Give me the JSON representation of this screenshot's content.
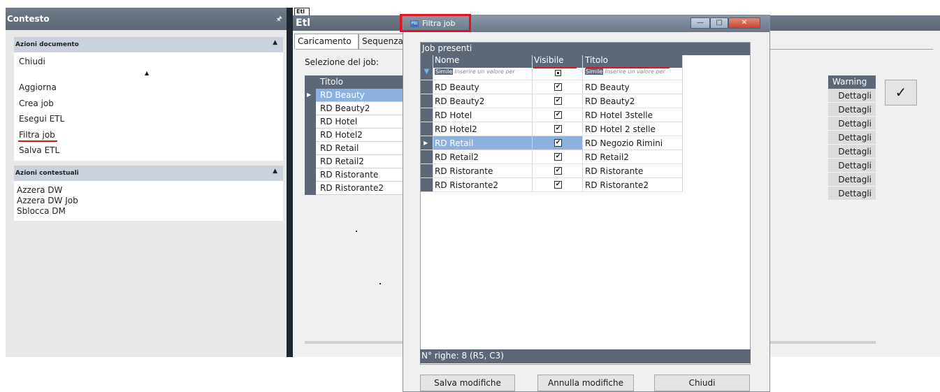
{
  "left_panel": {
    "title": "Contesto",
    "pin_icon": "pin-icon",
    "doc_actions": {
      "header": "Azioni documento",
      "items": [
        "Chiudi",
        "Aggiorna",
        "Crea job",
        "Esegui ETL",
        "Filtra job",
        "Salva ETL"
      ]
    },
    "context_actions": {
      "header": "Azioni contestuali",
      "items": [
        "Azzera DW",
        "Azzera DW Job",
        "Sblocca DM"
      ]
    }
  },
  "etl": {
    "doc_tab": "Etl",
    "title": "Etl",
    "tabs": [
      "Caricamento",
      "Sequenza"
    ],
    "selection_label": "Selezione del job:",
    "grid": {
      "header": "Titolo",
      "rows": [
        "RD Beauty",
        "RD Beauty2",
        "RD Hotel",
        "RD Hotel2",
        "RD Retail",
        "RD Retail2",
        "RD Ristorante",
        "RD Ristorante2"
      ],
      "selected_index": 0
    },
    "warning": {
      "header": "Warning",
      "rows": [
        "Dettagli",
        "Dettagli",
        "Dettagli",
        "Dettagli",
        "Dettagli",
        "Dettagli",
        "Dettagli",
        "Dettagli"
      ]
    },
    "confirm_glyph": "✓"
  },
  "dialog": {
    "title": "Filtra job",
    "panel_title": "Job presenti",
    "columns": [
      "Nome",
      "Visibile",
      "Titolo"
    ],
    "filter": {
      "simile_label": "Simile",
      "placeholder": "Inserire un valore per"
    },
    "rows": [
      {
        "nome": "RD Beauty",
        "visibile": true,
        "titolo": "RD Beauty"
      },
      {
        "nome": "RD Beauty2",
        "visibile": true,
        "titolo": "RD Beauty2"
      },
      {
        "nome": "RD Hotel",
        "visibile": true,
        "titolo": "RD Hotel 3stelle"
      },
      {
        "nome": "RD Hotel2",
        "visibile": true,
        "titolo": "RD Hotel 2 stelle"
      },
      {
        "nome": "RD Retail",
        "visibile": true,
        "titolo": "RD Negozio Rimini"
      },
      {
        "nome": "RD Retail2",
        "visibile": true,
        "titolo": "RD Retail2"
      },
      {
        "nome": "RD Ristorante",
        "visibile": true,
        "titolo": "RD Ristorante"
      },
      {
        "nome": "RD Ristorante2",
        "visibile": true,
        "titolo": "RD Ristorante2"
      }
    ],
    "selected_row": 4,
    "status": "N° righe: 8  (R5, C3)",
    "buttons": {
      "save": "Salva modifiche",
      "cancel": "Annulla modifiche",
      "close": "Chiudi"
    }
  },
  "colors": {
    "header_bg": "#5c6878",
    "selection": "#8cb1de",
    "highlight": "#e0151f"
  }
}
